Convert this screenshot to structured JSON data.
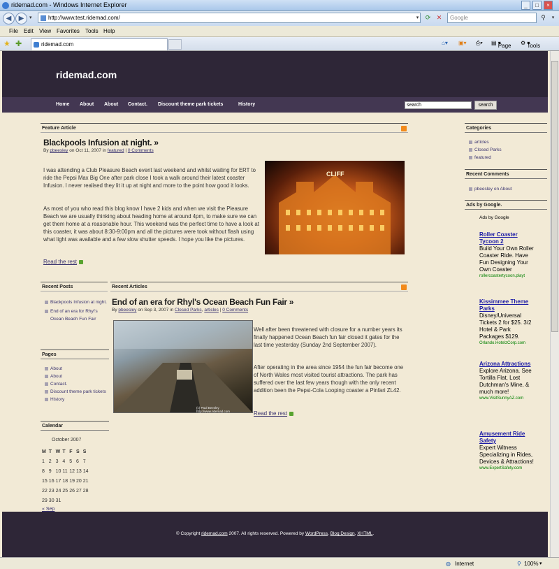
{
  "window": {
    "title": "ridemad.com - Windows Internet Explorer"
  },
  "address": {
    "url": "http://www.test.ridemad.com/",
    "search_placeholder": "Google"
  },
  "menu": [
    "File",
    "Edit",
    "View",
    "Favorites",
    "Tools",
    "Help"
  ],
  "tab": {
    "label": "ridemad.com"
  },
  "toolbar": {
    "page": "Page",
    "tools": "Tools"
  },
  "site": {
    "title": "ridemad.com",
    "nav": [
      "Home",
      "About",
      "About",
      "Contact.",
      "Discount theme park tickets",
      "History"
    ],
    "search_value": "search",
    "search_button": "search"
  },
  "feature": {
    "section": "Feature Article",
    "title": "Blackpools Infusion at night. »",
    "meta_by": "By",
    "meta_author": "pbeesley",
    "meta_on": "on Oct 11, 2007 in",
    "meta_cat": "featured",
    "meta_comments": "0 Comments",
    "p1": "I was attending a Club Pleasure Beach event last weekend and whilst waiting for ERT to ride the Pepsi Max Big One after park close I took a walk around their latest coaster Infusion. I never realised they lit it up at night and more to the point how good it looks.",
    "p2": "As most of you who read this blog know I have 2 kids and when we visit the Pleasure Beach we are usually thinking about heading home at around 4pm, to make sure we can get them home at a reasonable hour. This weekend was the perfect time to have a look at this coaster, it was about 8:30-9:00pm and all the pictures were took without flash using what light was available and a few slow shutter speeds. I hope you like the pictures.",
    "read_more": "Read the rest",
    "photo_sign": "CLIFF"
  },
  "recent_posts": {
    "heading": "Recent Posts",
    "items": [
      "Blackpools Infusion at night.",
      "End of an era for Rhyl's Ocean Beach Fun Fair"
    ]
  },
  "recent_articles": {
    "section": "Recent Articles",
    "title": "End of an era for Rhyl's Ocean Beach Fun Fair »",
    "meta_by": "By",
    "meta_author": "pbeesley",
    "meta_on": "on Sep 3, 2007 in",
    "meta_cat1": "Closed Parks",
    "meta_cat2": "articles",
    "meta_comments": "0 Comments",
    "p1": "Well after been threatened with closure for a number years its finally happened Ocean Beach fun fair closed it gates for the last time yesterday (Sunday 2nd September 2007).",
    "p2": "After operating in the area since 1954 the fun fair become one of North Wales most visited tourist attractions. The park has suffered over the last few years though with the only recent addition been the Pepsi-Cola Looping coaster a Pinfari ZL42.",
    "read_more": "Read the rest",
    "photo_credit": "(c) Paul Beesley http://www.ridemad.com"
  },
  "pages": {
    "heading": "Pages",
    "items": [
      "About",
      "About",
      "Contact.",
      "Discount theme park tickets",
      "History"
    ]
  },
  "calendar": {
    "heading": "Calendar",
    "month": "October 2007",
    "days": [
      "M",
      "T",
      "W",
      "T",
      "F",
      "S",
      "S"
    ],
    "weeks": [
      [
        "1",
        "2",
        "3",
        "4",
        "5",
        "6",
        "7"
      ],
      [
        "8",
        "9",
        "10",
        "11",
        "12",
        "13",
        "14"
      ],
      [
        "15",
        "16",
        "17",
        "18",
        "19",
        "20",
        "21"
      ],
      [
        "22",
        "23",
        "24",
        "25",
        "26",
        "27",
        "28"
      ],
      [
        "29",
        "30",
        "31",
        "",
        "",
        "",
        ""
      ]
    ],
    "prev": "« Sep"
  },
  "categories": {
    "heading": "Categories",
    "items": [
      "articles",
      "Closed Parks",
      "featured"
    ]
  },
  "recent_comments": {
    "heading": "Recent Comments",
    "items": [
      "pbeesley on About"
    ]
  },
  "ads": {
    "heading": "Ads by Google.",
    "label": "Ads by Google",
    "items": [
      {
        "title": "Roller Coaster Tycoon 2",
        "body": "Build Your Own Roller Coaster Ride. Have Fun Designing Your Own Coaster",
        "url": "rollercoastertycoon.playt"
      },
      {
        "title": "Kissimmee Theme Parks",
        "body": "Disney/Universal Tickets 2 for $25. 3/2 Hotel & Park Packages $129.",
        "url": "Orlando.HotelzCorp.com"
      },
      {
        "title": "Arizona Attractions",
        "body": "Explore Arizona. See Tortilla Flat, Lost Dutchman's Mine, & much more!",
        "url": "www.VisitSunnyAZ.com"
      },
      {
        "title": "Amusement Ride Safety",
        "body": "Expert Witness Specializing in Rides, Devices & Attractions!",
        "url": "www.ExpertSafety.com"
      }
    ]
  },
  "footer": {
    "prefix": "© Copyright",
    "site": "ridemad.com",
    "mid": "2007. All rights reserved. Powered by",
    "wp": "WordPress",
    "sep": ",",
    "design": "Blog Design",
    "xhtml": "XHTML",
    "end": "."
  },
  "status": {
    "zone": "Internet",
    "zoom": "100%"
  }
}
